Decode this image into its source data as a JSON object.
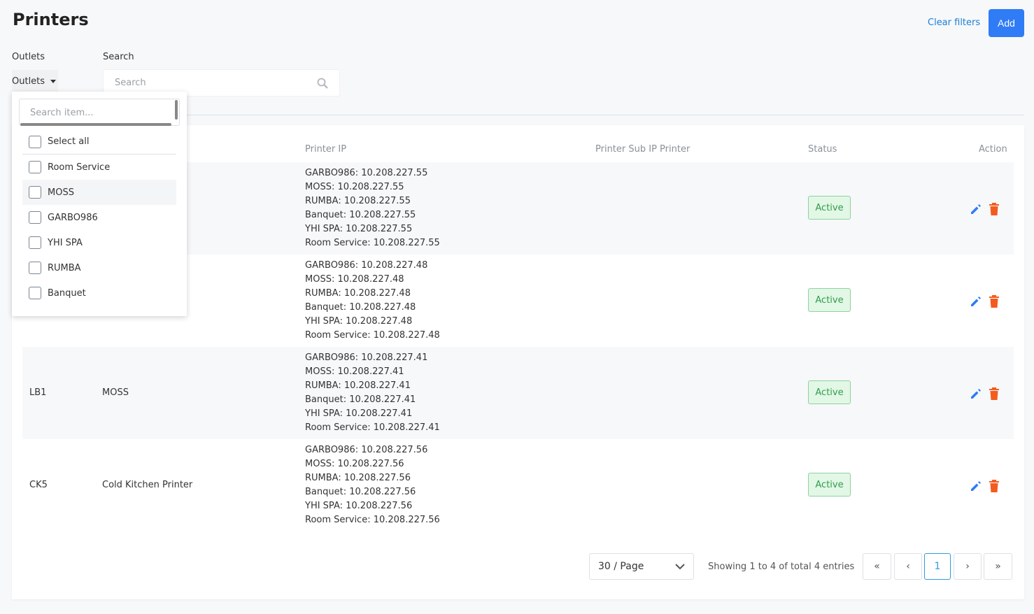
{
  "page": {
    "title": "Printers",
    "clear_filters": "Clear filters",
    "add": "Add"
  },
  "filters": {
    "outlets_label": "Outlets",
    "outlets_value": "Outlets",
    "search_label": "Search",
    "search_placeholder": "Search"
  },
  "dropdown": {
    "search_placeholder": "Search item...",
    "select_all": "Select all",
    "options": [
      "Room Service",
      "MOSS",
      "GARBO986",
      "YHI SPA",
      "RUMBA",
      "Banquet"
    ]
  },
  "table": {
    "headers": {
      "ip": "Printer IP",
      "sub_ip": "Printer Sub IP Printer",
      "status": "Status",
      "action": "Action"
    },
    "rows": [
      {
        "code": "",
        "name": "",
        "ips": [
          "GARBO986: 10.208.227.55",
          "MOSS: 10.208.227.55",
          "RUMBA: 10.208.227.55",
          "Banquet: 10.208.227.55",
          "YHI SPA: 10.208.227.55",
          "Room Service: 10.208.227.55"
        ],
        "status": "Active"
      },
      {
        "code": "",
        "name": "",
        "ips": [
          "GARBO986: 10.208.227.48",
          "MOSS: 10.208.227.48",
          "RUMBA: 10.208.227.48",
          "Banquet: 10.208.227.48",
          "YHI SPA: 10.208.227.48",
          "Room Service: 10.208.227.48"
        ],
        "status": "Active"
      },
      {
        "code": "LB1",
        "name": "MOSS",
        "ips": [
          "GARBO986: 10.208.227.41",
          "MOSS: 10.208.227.41",
          "RUMBA: 10.208.227.41",
          "Banquet: 10.208.227.41",
          "YHI SPA: 10.208.227.41",
          "Room Service: 10.208.227.41"
        ],
        "status": "Active"
      },
      {
        "code": "CK5",
        "name": "Cold Kitchen Printer",
        "ips": [
          "GARBO986: 10.208.227.56",
          "MOSS: 10.208.227.56",
          "RUMBA: 10.208.227.56",
          "Banquet: 10.208.227.56",
          "YHI SPA: 10.208.227.56",
          "Room Service: 10.208.227.56"
        ],
        "status": "Active"
      }
    ]
  },
  "pagination": {
    "page_size": "30 / Page",
    "summary": "Showing 1 to 4 of total 4 entries",
    "current_page": "1"
  },
  "colors": {
    "accent": "#2f7cf6",
    "delete": "#f45b1f",
    "active_bg": "#e2f7e6"
  }
}
